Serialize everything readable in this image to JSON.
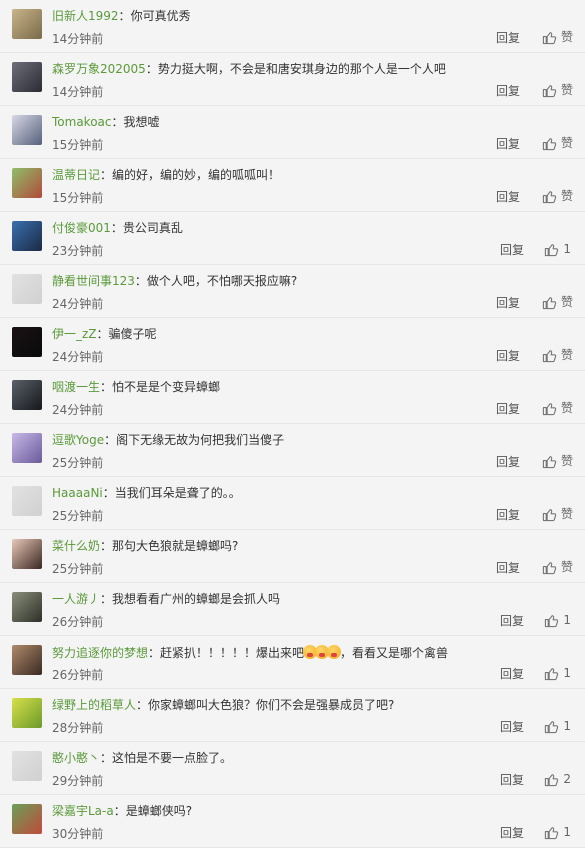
{
  "comments": [
    {
      "user": "旧新人1992",
      "text": "你可真优秀",
      "time": "14分钟前",
      "reply": "回复",
      "likes": "赞",
      "avatar_colors": [
        "#c9b48a",
        "#7a6a4a"
      ]
    },
    {
      "user": "森罗万象202005",
      "text": "势力挺大啊，不会是和唐安琪身边的那个人是一个人吧",
      "time": "14分钟前",
      "reply": "回复",
      "likes": "赞",
      "avatar_colors": [
        "#6e6e7a",
        "#2b2b33"
      ]
    },
    {
      "user": "Tomakoac",
      "text": "我想嘘",
      "time": "15分钟前",
      "reply": "回复",
      "likes": "赞",
      "avatar_colors": [
        "#d8d8e6",
        "#55607a"
      ]
    },
    {
      "user": "温蒂日记",
      "text": "编的好，编的妙，编的呱呱叫！",
      "time": "15分钟前",
      "reply": "回复",
      "likes": "赞",
      "avatar_colors": [
        "#8fbf6a",
        "#b04a3a"
      ]
    },
    {
      "user": "付俊豪001",
      "text": "贵公司真乱",
      "time": "23分钟前",
      "reply": "回复",
      "likes": "1",
      "avatar_colors": [
        "#3b6fb0",
        "#1a2a44"
      ]
    },
    {
      "user": "静看世间事123",
      "text": "做个人吧，不怕哪天报应嘛?",
      "time": "24分钟前",
      "reply": "回复",
      "likes": "赞",
      "avatar_colors": [
        "#e2e2e2",
        "#d0d0d0"
      ]
    },
    {
      "user": "伊一_zZ",
      "text": "骗傻子呢",
      "time": "24分钟前",
      "reply": "回复",
      "likes": "赞",
      "avatar_colors": [
        "#1a1214",
        "#0a0a0a"
      ]
    },
    {
      "user": "咽渡一生",
      "text": "怕不是是个变异蟑螂",
      "time": "24分钟前",
      "reply": "回复",
      "likes": "赞",
      "avatar_colors": [
        "#5a6068",
        "#15181c"
      ]
    },
    {
      "user": "逗歌Yoge",
      "text": "阁下无缘无故为何把我们当傻子",
      "time": "25分钟前",
      "reply": "回复",
      "likes": "赞",
      "avatar_colors": [
        "#c7b8e8",
        "#6a5a9a"
      ]
    },
    {
      "user": "HaaaaNi",
      "text": "当我们耳朵是聋了的。。",
      "time": "25分钟前",
      "reply": "回复",
      "likes": "赞",
      "avatar_colors": [
        "#e2e2e2",
        "#d0d0d0"
      ]
    },
    {
      "user": "菜什么奶",
      "text": "那句大色狼就是蟑螂吗?",
      "time": "25分钟前",
      "reply": "回复",
      "likes": "赞",
      "avatar_colors": [
        "#e8c9b8",
        "#3a2622"
      ]
    },
    {
      "user": "一人游丿",
      "text": "我想看看广州的蟑螂是会抓人吗",
      "time": "26分钟前",
      "reply": "回复",
      "likes": "1",
      "avatar_colors": [
        "#8a8f7a",
        "#2e3028"
      ]
    },
    {
      "user": "努力追逐你的梦想",
      "text_before": "赶紧扒！！！！！爆出来吧",
      "text_after": "，看看又是哪个禽兽",
      "emoji_count": 3,
      "time": "26分钟前",
      "reply": "回复",
      "likes": "1",
      "avatar_colors": [
        "#b08a6a",
        "#3a2a22"
      ]
    },
    {
      "user": "绿野上的稻草人",
      "text": "你家蟑螂叫大色狼？你们不会是强暴成员了吧?",
      "time": "28分钟前",
      "reply": "回复",
      "likes": "1",
      "avatar_colors": [
        "#d8e04a",
        "#6a9a2a"
      ]
    },
    {
      "user": "憨小憨丶",
      "text": "这怕是不要一点脸了。",
      "time": "29分钟前",
      "reply": "回复",
      "likes": "2",
      "avatar_colors": [
        "#e2e2e2",
        "#d0d0d0"
      ]
    },
    {
      "user": "梁嘉宇La-a",
      "text": "是蟑螂侠吗?",
      "time": "30分钟前",
      "reply": "回复",
      "likes": "1",
      "avatar_colors": [
        "#6aa05a",
        "#c04a3a"
      ]
    }
  ],
  "colors": {
    "username": "#5a9a3a",
    "text": "#333333",
    "meta": "#666666",
    "background": "#f4f4f4"
  }
}
